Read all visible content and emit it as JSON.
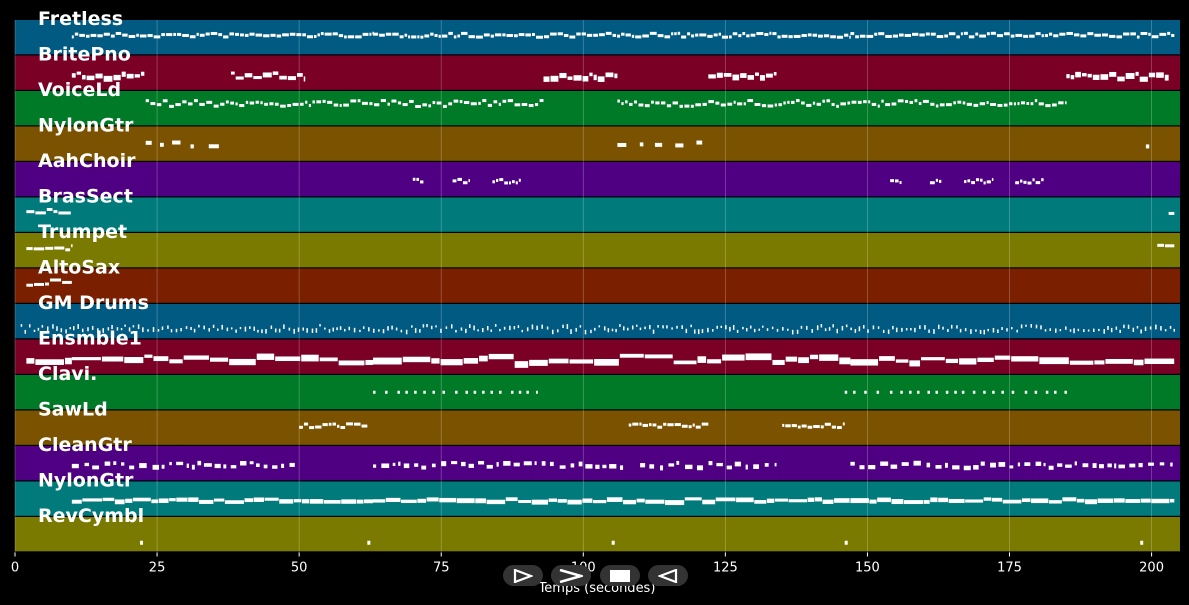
{
  "chart_data": {
    "type": "piano-roll",
    "xlabel": "Temps (secondes)",
    "xlim": [
      0,
      205
    ],
    "x_ticks": [
      0,
      25,
      50,
      75,
      100,
      125,
      150,
      175,
      200
    ],
    "grid": true,
    "tracks": [
      {
        "name": "Fretless",
        "color": "#005a82",
        "segments": [
          [
            10,
            63
          ],
          [
            63,
            147
          ],
          [
            147,
            204
          ]
        ],
        "style": "dense-low"
      },
      {
        "name": "BritePno",
        "color": "#7a0026",
        "segments": [
          [
            10,
            23
          ],
          [
            38,
            51
          ],
          [
            93,
            106
          ],
          [
            122,
            134
          ],
          [
            185,
            203
          ]
        ],
        "style": "blocks"
      },
      {
        "name": "VoiceLd",
        "color": "#007a26",
        "segments": [
          [
            23,
            93
          ],
          [
            106,
            185
          ]
        ],
        "style": "dense"
      },
      {
        "name": "NylonGtr",
        "color": "#7a5200",
        "segments": [
          [
            23,
            38
          ],
          [
            106,
            122
          ],
          [
            199,
            200
          ]
        ],
        "style": "sparse-blocks"
      },
      {
        "name": "AahChoir",
        "color": "#4f0082",
        "segments": [
          [
            70,
            72
          ],
          [
            77,
            80
          ],
          [
            84,
            89
          ],
          [
            154,
            156
          ],
          [
            161,
            163
          ],
          [
            167,
            172
          ],
          [
            176,
            181
          ]
        ],
        "style": "short-blocks"
      },
      {
        "name": "BrasSect",
        "color": "#007a7a",
        "segments": [
          [
            2,
            10
          ],
          [
            203,
            204
          ]
        ],
        "style": "intro"
      },
      {
        "name": "Trumpet",
        "color": "#7a7a00",
        "segments": [
          [
            2,
            10
          ],
          [
            201,
            204
          ]
        ],
        "style": "intro"
      },
      {
        "name": "AltoSax",
        "color": "#7a1f00",
        "segments": [
          [
            2,
            10
          ]
        ],
        "style": "intro"
      },
      {
        "name": "GM Drums",
        "color": "#005a82",
        "segments": [
          [
            1,
            63
          ],
          [
            63,
            147
          ],
          [
            147,
            204
          ]
        ],
        "style": "drums"
      },
      {
        "name": "Ensmble1",
        "color": "#7a0026",
        "segments": [
          [
            2,
            10
          ],
          [
            10,
            63
          ],
          [
            63,
            147
          ],
          [
            147,
            204
          ]
        ],
        "style": "pads"
      },
      {
        "name": "Clavi.",
        "color": "#007a26",
        "segments": [
          [
            63,
            92
          ],
          [
            146,
            186
          ]
        ],
        "style": "dots"
      },
      {
        "name": "SawLd",
        "color": "#7a5200",
        "segments": [
          [
            50,
            62
          ],
          [
            108,
            122
          ],
          [
            135,
            146
          ]
        ],
        "style": "dense-low"
      },
      {
        "name": "CleanGtr",
        "color": "#4f0082",
        "segments": [
          [
            10,
            50
          ],
          [
            63,
            107
          ],
          [
            110,
            134
          ],
          [
            147,
            204
          ]
        ],
        "style": "mixed"
      },
      {
        "name": "NylonGtr",
        "color": "#007a7a",
        "segments": [
          [
            10,
            63
          ],
          [
            63,
            147
          ],
          [
            147,
            204
          ]
        ],
        "style": "continuous"
      },
      {
        "name": "RevCymbl",
        "color": "#7a7a00",
        "points": [
          22,
          62,
          105,
          146,
          198
        ],
        "style": "points"
      }
    ]
  },
  "controls": {
    "play_icon": "play-icon",
    "forward_icon": "fast-forward-icon",
    "stop_icon": "stop-icon",
    "rewind_icon": "rewind-icon"
  }
}
